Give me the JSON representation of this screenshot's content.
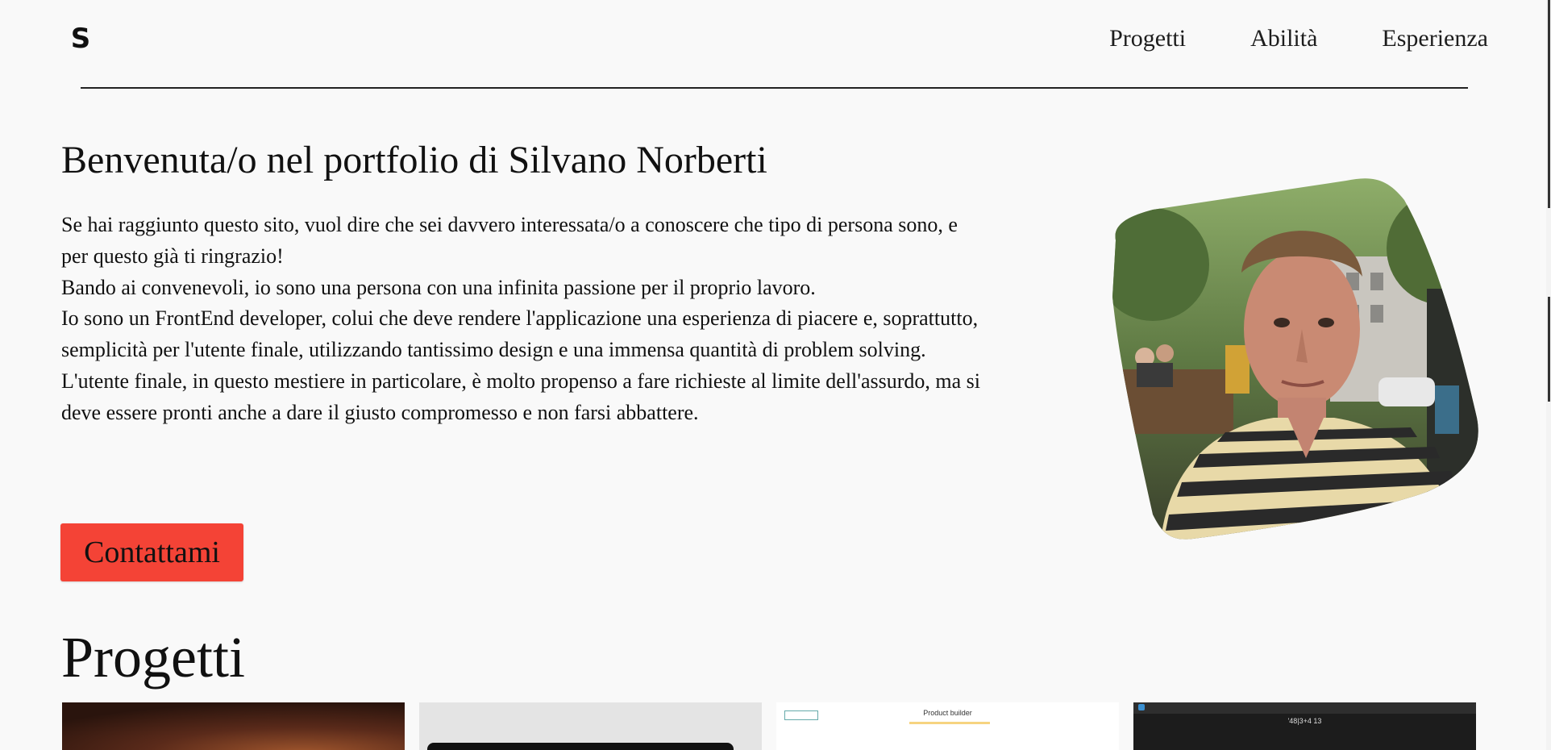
{
  "header": {
    "logo_text": "S",
    "nav": [
      {
        "label": "Progetti"
      },
      {
        "label": "Abilità"
      },
      {
        "label": "Esperienza"
      }
    ]
  },
  "hero": {
    "title": "Benvenuta/o nel portfolio di Silvano Norberti",
    "paragraphs": [
      "Se hai raggiunto questo sito, vuol dire che sei davvero interessata/o a conoscere che tipo di persona sono, e per questo già ti ringrazio!",
      "Bando ai convenevoli, io sono una persona con una infinita passione per il proprio lavoro.",
      "Io sono un FrontEnd developer, colui che deve rendere l'applicazione una esperienza di piacere e, soprattutto, semplicità per l'utente finale, utilizzando tantissimo design e una immensa quantità di problem solving.",
      "L'utente finale, in questo mestiere in particolare, è molto propenso a fare richieste al limite dell'assurdo, ma si deve essere pronti anche a dare il giusto compromesso e non farsi abbattere."
    ],
    "cta_label": "Contattami"
  },
  "projects": {
    "title": "Progetti",
    "cards": [
      {
        "label": ""
      },
      {
        "label": ""
      },
      {
        "label": "Product builder"
      },
      {
        "label": "'48|3+4 13"
      }
    ]
  },
  "colors": {
    "background": "#f9f9f9",
    "accent": "#f44336",
    "text": "#111111"
  }
}
